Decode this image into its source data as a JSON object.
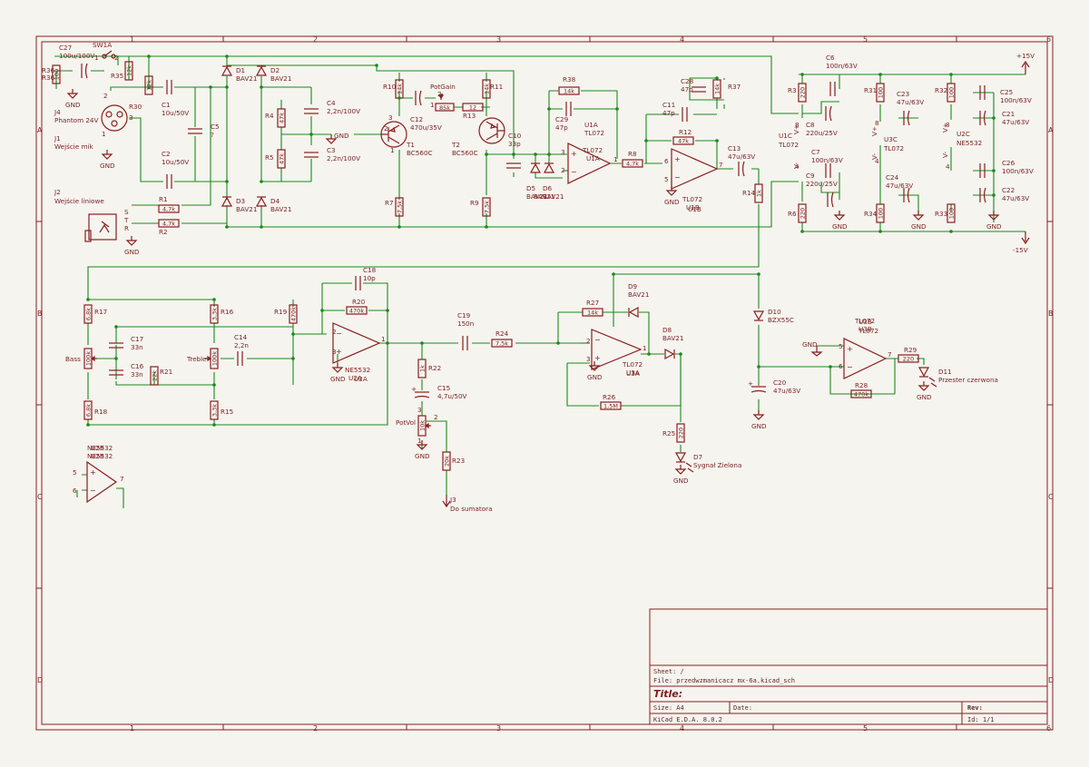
{
  "frame": {
    "col_labels": [
      "1",
      "2",
      "3",
      "4",
      "5",
      "6"
    ],
    "row_labels": [
      "A",
      "B",
      "C",
      "D"
    ]
  },
  "title_block": {
    "sheet": "Sheet: /",
    "file": "File: przedwzmanicacz mx-6a.kicad_sch",
    "title": "Title:",
    "size": "Size: A4",
    "date": "Date:",
    "rev": "Rev:",
    "tool": "KiCad E.D.A. 8.0.2",
    "id": "Id: 1/1"
  },
  "components": {
    "J4": {
      "ref": "J4",
      "value": "Phantom 24V"
    },
    "R36": {
      "ref": "R36",
      "value": "100"
    },
    "C27": {
      "ref": "C27",
      "value": "100u/100V"
    },
    "SW1A": {
      "ref": "SW1A"
    },
    "R35": {
      "ref": "R35",
      "value": "12k"
    },
    "R30": {
      "ref": "R30",
      "value": "12k"
    },
    "J1": {
      "ref": "J1",
      "value": "Wejście mik"
    },
    "C1": {
      "ref": "C1",
      "value": "10u/50V"
    },
    "C2": {
      "ref": "C2",
      "value": "10u/50V"
    },
    "C5": {
      "ref": "C5",
      "value": "?"
    },
    "J2": {
      "ref": "J2",
      "value": "Wejście liniowe"
    },
    "R1": {
      "ref": "R1",
      "value": "4,7k"
    },
    "R2": {
      "ref": "R2",
      "value": "4,7k"
    },
    "D1": {
      "ref": "D1",
      "value": "BAV21"
    },
    "D2": {
      "ref": "D2",
      "value": "BAV21"
    },
    "D3": {
      "ref": "D3",
      "value": "BAV21"
    },
    "D4": {
      "ref": "D4",
      "value": "BAV21"
    },
    "R4": {
      "ref": "R4",
      "value": "47k"
    },
    "R5": {
      "ref": "R5",
      "value": "47k"
    },
    "C4": {
      "ref": "C4",
      "value": "2,2n/100V"
    },
    "C3": {
      "ref": "C3",
      "value": "2,2n/100V"
    },
    "R10": {
      "ref": "R10",
      "value": "14k"
    },
    "C12": {
      "ref": "C12",
      "value": "470u/35V"
    },
    "PotGain": {
      "ref": "PotGain",
      "value": "85k"
    },
    "R13": {
      "ref": "R13",
      "value": "12"
    },
    "R11": {
      "ref": "R11",
      "value": "14k"
    },
    "T1": {
      "ref": "T1",
      "value": "BC560C"
    },
    "T2": {
      "ref": "T2",
      "value": "BC560C"
    },
    "R7": {
      "ref": "R7",
      "value": "7,5k"
    },
    "R9": {
      "ref": "R9",
      "value": "7,5k"
    },
    "C10": {
      "ref": "C10",
      "value": "33p"
    },
    "D5": {
      "ref": "D5",
      "value": "BAV21"
    },
    "D6": {
      "ref": "D6",
      "value": "BAV21"
    },
    "R38": {
      "ref": "R38",
      "value": "14k"
    },
    "C29": {
      "ref": "C29",
      "value": "47p"
    },
    "U1A": {
      "ref": "U1A",
      "value": "TL072"
    },
    "R8": {
      "ref": "R8",
      "value": "4,7k"
    },
    "C28": {
      "ref": "C28",
      "value": "47p"
    },
    "R37": {
      "ref": "R37",
      "value": "14k"
    },
    "C11": {
      "ref": "C11",
      "value": "47p"
    },
    "R12": {
      "ref": "R12",
      "value": "47k"
    },
    "U1B": {
      "ref": "U1B",
      "value": "TL072"
    },
    "C13": {
      "ref": "C13",
      "value": "47u/63V"
    },
    "R14": {
      "ref": "R14",
      "value": "1k"
    },
    "R3": {
      "ref": "R3",
      "value": "220"
    },
    "R6": {
      "ref": "R6",
      "value": "220"
    },
    "C6": {
      "ref": "C6",
      "value": "100n/63V"
    },
    "C8": {
      "ref": "C8",
      "value": "220u/25V"
    },
    "C7": {
      "ref": "C7",
      "value": "100n/63V"
    },
    "C9": {
      "ref": "C9",
      "value": "220u/25V"
    },
    "U1C": {
      "ref": "U1C",
      "value": "TL072"
    },
    "R31": {
      "ref": "R31",
      "value": "100"
    },
    "R34": {
      "ref": "R34",
      "value": "100"
    },
    "C23": {
      "ref": "C23",
      "value": "47u/63V"
    },
    "C24": {
      "ref": "C24",
      "value": "47u/63V"
    },
    "U3C": {
      "ref": "U3C",
      "value": "TL072"
    },
    "R32": {
      "ref": "R32",
      "value": "100"
    },
    "R33": {
      "ref": "R33",
      "value": "100"
    },
    "U2C": {
      "ref": "U2C",
      "value": "NE5532"
    },
    "C25": {
      "ref": "C25",
      "value": "100n/63V"
    },
    "C21": {
      "ref": "C21",
      "value": "47u/63V"
    },
    "C26": {
      "ref": "C26",
      "value": "100n/63V"
    },
    "C22": {
      "ref": "C22",
      "value": "47u/63V"
    },
    "R17": {
      "ref": "R17",
      "value": "6,8k"
    },
    "R18": {
      "ref": "R18",
      "value": "6,8k"
    },
    "Bass": {
      "ref": "Bass",
      "value": "100k"
    },
    "C17": {
      "ref": "C17",
      "value": "33n"
    },
    "C16": {
      "ref": "C16",
      "value": "33n"
    },
    "R21": {
      "ref": "R21",
      "value": "22k"
    },
    "R16": {
      "ref": "R16",
      "value": "3,3k"
    },
    "R15": {
      "ref": "R15",
      "value": "3,3k"
    },
    "Treble": {
      "ref": "Treble",
      "value": "100k"
    },
    "C14": {
      "ref": "C14",
      "value": "2,2n"
    },
    "R19": {
      "ref": "R19",
      "value": "470k"
    },
    "C18": {
      "ref": "C18",
      "value": "10p"
    },
    "R20": {
      "ref": "R20",
      "value": "470k"
    },
    "U2A": {
      "ref": "U2A",
      "value": "NE5532"
    },
    "C19": {
      "ref": "C19",
      "value": "150n"
    },
    "R24": {
      "ref": "R24",
      "value": "7,5k"
    },
    "R22": {
      "ref": "R22",
      "value": "1k"
    },
    "C15": {
      "ref": "C15",
      "value": "4,7u/50V"
    },
    "PotVol": {
      "ref": "PotVol",
      "value": "10k"
    },
    "R23": {
      "ref": "R23",
      "value": "20k"
    },
    "J3": {
      "ref": "J3",
      "value": "Do sumatora"
    },
    "R27": {
      "ref": "R27",
      "value": "14k"
    },
    "D9": {
      "ref": "D9",
      "value": "BAV21"
    },
    "D8": {
      "ref": "D8",
      "value": "BAV21"
    },
    "U3A": {
      "ref": "U3A",
      "value": "TL072"
    },
    "R26": {
      "ref": "R26",
      "value": "1,5M"
    },
    "R25": {
      "ref": "R25",
      "value": "220"
    },
    "D7": {
      "ref": "D7",
      "value": "Sygnał Zielona"
    },
    "D10": {
      "ref": "D10",
      "value": "BZX55C"
    },
    "C20": {
      "ref": "C20",
      "value": "47u/63V"
    },
    "U3B": {
      "ref": "U3B",
      "value": "TL072"
    },
    "R29": {
      "ref": "R29",
      "value": "220"
    },
    "R28": {
      "ref": "R28",
      "value": "470k"
    },
    "D11": {
      "ref": "D11",
      "value": "Przester czerwona"
    },
    "U2B": {
      "ref": "U2B",
      "value": "NE5532"
    }
  },
  "power": {
    "plus": "+15V",
    "minus": "-15V",
    "gnd": "GND",
    "vplus": "V+",
    "vminus": "V-"
  },
  "pins": {
    "p1": "1",
    "p2": "2",
    "p3": "3",
    "p4": "4",
    "p5": "5",
    "p6": "6",
    "p7": "7",
    "p8": "8",
    "S": "S",
    "T": "T",
    "R": "R"
  }
}
